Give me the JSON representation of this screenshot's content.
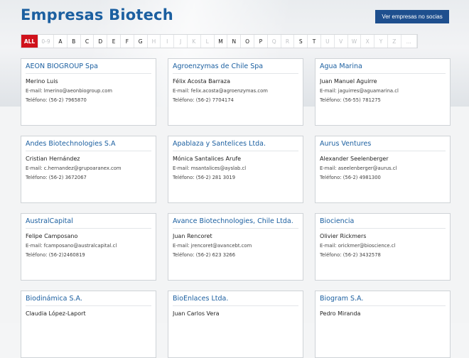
{
  "header": {
    "title": "Empresas Biotech",
    "cta_label": "Ver empresas no socias"
  },
  "alphabet": [
    {
      "label": "ALL",
      "state": "active"
    },
    {
      "label": "0-9",
      "state": "disabled"
    },
    {
      "label": "A",
      "state": "enabled"
    },
    {
      "label": "B",
      "state": "enabled"
    },
    {
      "label": "C",
      "state": "enabled"
    },
    {
      "label": "D",
      "state": "enabled"
    },
    {
      "label": "E",
      "state": "enabled"
    },
    {
      "label": "F",
      "state": "enabled"
    },
    {
      "label": "G",
      "state": "enabled"
    },
    {
      "label": "H",
      "state": "disabled"
    },
    {
      "label": "I",
      "state": "disabled"
    },
    {
      "label": "J",
      "state": "disabled"
    },
    {
      "label": "K",
      "state": "disabled"
    },
    {
      "label": "L",
      "state": "disabled"
    },
    {
      "label": "M",
      "state": "enabled"
    },
    {
      "label": "N",
      "state": "enabled"
    },
    {
      "label": "O",
      "state": "enabled"
    },
    {
      "label": "P",
      "state": "enabled"
    },
    {
      "label": "Q",
      "state": "disabled"
    },
    {
      "label": "R",
      "state": "disabled"
    },
    {
      "label": "S",
      "state": "enabled"
    },
    {
      "label": "T",
      "state": "enabled"
    },
    {
      "label": "U",
      "state": "disabled"
    },
    {
      "label": "V",
      "state": "disabled"
    },
    {
      "label": "W",
      "state": "disabled"
    },
    {
      "label": "X",
      "state": "disabled"
    },
    {
      "label": "Y",
      "state": "disabled"
    },
    {
      "label": "Z",
      "state": "disabled"
    },
    {
      "label": "...",
      "state": "disabled"
    }
  ],
  "companies": [
    {
      "name": "AEON BIOGROUP Spa",
      "contact": "Merino Luis",
      "email": "E-mail: lmerino@aeonbiogroup.com",
      "phone": "Teléfono: (56-2) 7965870"
    },
    {
      "name": "Agroenzymas de Chile Spa",
      "contact": "Félix Acosta Barraza",
      "email": "E-mail: felix.acosta@agroenzymas.com",
      "phone": "Teléfono: (56-2) 7704174"
    },
    {
      "name": "Agua Marina",
      "contact": "Juan Manuel Aguirre",
      "email": "E-mail: jaguirres@aguamarina.cl",
      "phone": "Teléfono: (56-55) 781275"
    },
    {
      "name": "Andes Biotechnologies S.A",
      "contact": "Cristian Hernández",
      "email": "E-mail: c.hernandez@grupoaranex.com",
      "phone": "Teléfono: (56-2) 3672067"
    },
    {
      "name": "Apablaza y Santelices Ltda.",
      "contact": "Mónica Santalices Arufe",
      "email": "E-mail: msantalices@ayslab.cl",
      "phone": "Teléfono: (56-2) 281 3019"
    },
    {
      "name": "Aurus Ventures",
      "contact": "Alexander Seelenberger",
      "email": "E-mail: aseelenberger@aurus.cl",
      "phone": "Teléfono: (56-2) 4981300"
    },
    {
      "name": "AustralCapital",
      "contact": "Felipe Camposano",
      "email": "E-mail: fcamposano@australcapital.cl",
      "phone": "Teléfono: (56-2)2460819"
    },
    {
      "name": "Avance Biotechnologies, Chile Ltda.",
      "contact": "Juan Rencoret",
      "email": "E-mail: jrencoret@avancebt.com",
      "phone": "Teléfono: (56-2) 623 3266"
    },
    {
      "name": "Biociencia",
      "contact": "Olivier Rickmers",
      "email": "E-mail: orickmer@bioscience.cl",
      "phone": "Teléfono: (56-2) 3432578"
    },
    {
      "name": "Biodinámica S.A.",
      "contact": "Claudia López-Laport",
      "email": "",
      "phone": ""
    },
    {
      "name": "BioEnlaces Ltda.",
      "contact": "Juan Carlos Vera",
      "email": "",
      "phone": ""
    },
    {
      "name": "Biogram S.A.",
      "contact": "Pedro Miranda",
      "email": "",
      "phone": ""
    }
  ]
}
